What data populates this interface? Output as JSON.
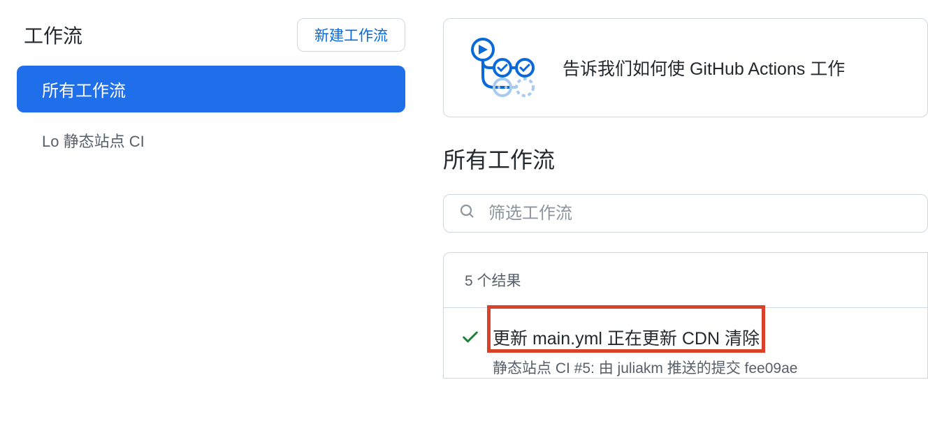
{
  "sidebar": {
    "title": "工作流",
    "new_button": "新建工作流",
    "items": [
      {
        "label": "所有工作流",
        "active": true
      },
      {
        "label": "Lo 静态站点 CI",
        "active": false
      }
    ]
  },
  "banner": {
    "text": "告诉我们如何使 GitHub Actions 工作"
  },
  "main": {
    "title": "所有工作流",
    "filter_placeholder": "筛选工作流",
    "results_count": "5 个结果",
    "result": {
      "title": "更新 main.yml 正在更新 CDN 清除",
      "subtitle": "静态站点 CI #5: 由 juliakm 推送的提交 fee09ae"
    }
  },
  "icons": {
    "search": "search-icon",
    "check": "check-icon",
    "workflow": "workflow-icon"
  }
}
